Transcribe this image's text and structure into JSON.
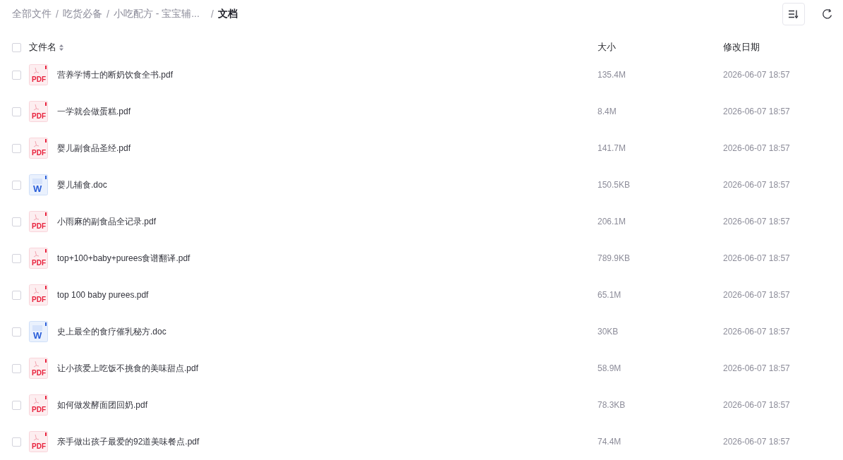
{
  "breadcrumb": [
    {
      "label": "全部文件",
      "current": false
    },
    {
      "separator": "/",
      "label": "吃货必备",
      "current": false
    },
    {
      "separator": "/",
      "label": "小吃配方 - 宝宝辅...",
      "current": false
    },
    {
      "separator": "/",
      "label": "文档",
      "current": true
    }
  ],
  "table": {
    "select_all": {
      "checked": false
    },
    "columns": [
      {
        "label": "文件名",
        "sortable": true
      },
      {
        "label": "大小",
        "sortable": false
      },
      {
        "label": "修改日期",
        "sortable": false
      }
    ],
    "rows": [
      {
        "checked": false,
        "kind": "pdf",
        "badge": "PDF",
        "name": "营养学博士的断奶饮食全书.pdf",
        "size": "135.4M",
        "modified": "2026-06-07 18:57"
      },
      {
        "checked": false,
        "kind": "pdf",
        "badge": "PDF",
        "name": "一学就会做蛋糕.pdf",
        "size": "8.4M",
        "modified": "2026-06-07 18:57"
      },
      {
        "checked": false,
        "kind": "pdf",
        "badge": "PDF",
        "name": "婴儿副食品圣经.pdf",
        "size": "141.7M",
        "modified": "2026-06-07 18:57"
      },
      {
        "checked": false,
        "kind": "doc",
        "badge": "W",
        "name": "婴儿辅食.doc",
        "size": "150.5KB",
        "modified": "2026-06-07 18:57"
      },
      {
        "checked": false,
        "kind": "pdf",
        "badge": "PDF",
        "name": "小雨麻的副食品全记录.pdf",
        "size": "206.1M",
        "modified": "2026-06-07 18:57"
      },
      {
        "checked": false,
        "kind": "pdf",
        "badge": "PDF",
        "name": "top+100+baby+purees食谱翻译.pdf",
        "size": "789.9KB",
        "modified": "2026-06-07 18:57"
      },
      {
        "checked": false,
        "kind": "pdf",
        "badge": "PDF",
        "name": "top 100 baby purees.pdf",
        "size": "65.1M",
        "modified": "2026-06-07 18:57"
      },
      {
        "checked": false,
        "kind": "doc",
        "badge": "W",
        "name": "史上最全的食疗催乳秘方.doc",
        "size": "30KB",
        "modified": "2026-06-07 18:57"
      },
      {
        "checked": false,
        "kind": "pdf",
        "badge": "PDF",
        "name": "让小孩爱上吃饭不挑食的美味甜点.pdf",
        "size": "58.9M",
        "modified": "2026-06-07 18:57"
      },
      {
        "checked": false,
        "kind": "pdf",
        "badge": "PDF",
        "name": "如何做发酵面团回奶.pdf",
        "size": "78.3KB",
        "modified": "2026-06-07 18:57"
      },
      {
        "checked": false,
        "kind": "pdf",
        "badge": "PDF",
        "name": "亲手做出孩子最爱的92道美味餐点.pdf",
        "size": "74.4M",
        "modified": "2026-06-07 18:57"
      }
    ]
  }
}
